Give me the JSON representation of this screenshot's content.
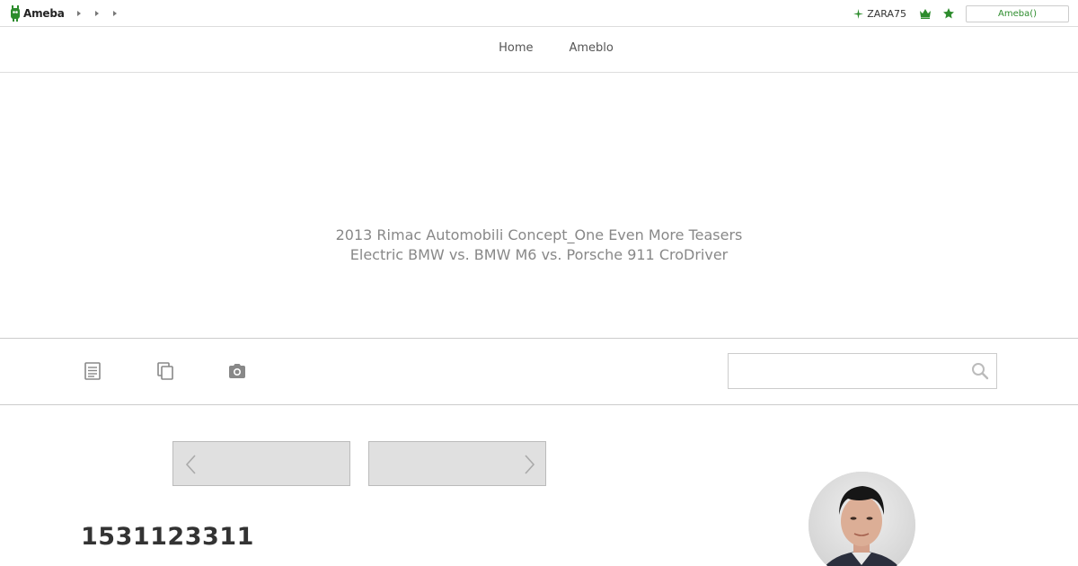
{
  "header": {
    "logo_text": "Ameba",
    "user_name": "ZARA75",
    "account_button": "Ameba()"
  },
  "nav": {
    "links": [
      "Home",
      "Ameblo"
    ]
  },
  "hero": {
    "title_line1": "2013 Rimac Automobili Concept_One Even More Teasers",
    "title_line2": "Electric BMW vs. BMW M6 vs. Porsche 911 CroDriver"
  },
  "search": {
    "value": "",
    "placeholder": ""
  },
  "profile": {
    "blog_id": "1531123311"
  },
  "colors": {
    "accent_green": "#2d8c2d",
    "pager_bg": "#e0e0e0",
    "icon_gray": "#888888"
  },
  "icons": [
    "ameba-logo-icon",
    "chevron-right-icon",
    "sparkle-icon",
    "crown-icon",
    "star-icon",
    "article-list-icon",
    "copy-pages-icon",
    "camera-icon",
    "search-icon",
    "chevron-left-icon"
  ]
}
